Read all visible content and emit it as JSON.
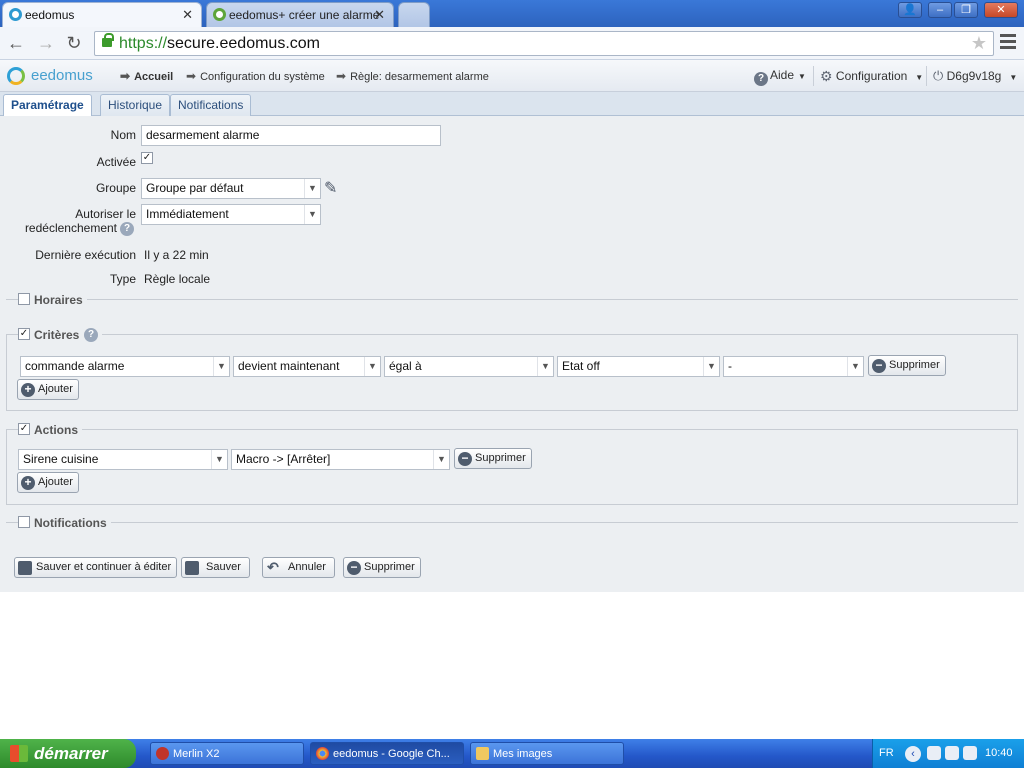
{
  "browser": {
    "tabs": [
      {
        "label": "eedomus",
        "close": "✕"
      },
      {
        "label": "eedomus+ créer une alarme",
        "close": "✕"
      }
    ],
    "url_scheme": "https://",
    "url_rest": "secure.eedomus.com",
    "window_controls": [
      "👤",
      "–",
      "❐",
      "✕"
    ]
  },
  "app": {
    "logo_text": "eedomus",
    "breadcrumb": [
      "Accueil",
      "Configuration du système",
      "Règle: desarmement alarme"
    ],
    "menu": {
      "help": "Aide",
      "config": "Configuration",
      "user": "D6g9v18g"
    },
    "subtabs": [
      "Paramétrage",
      "Historique",
      "Notifications"
    ]
  },
  "form": {
    "name_label": "Nom",
    "name_value": "desarmement alarme",
    "active_label": "Activée",
    "active_checked": true,
    "group_label": "Groupe",
    "group_value": "Groupe par défaut",
    "retrigger_label_1": "Autoriser le",
    "retrigger_label_2": "redéclenchement",
    "retrigger_value": "Immédiatement",
    "last_exec_label": "Dernière exécution",
    "last_exec_value": "Il y a 22 min",
    "type_label": "Type",
    "type_value": "Règle locale"
  },
  "sections": {
    "horaires": {
      "label": "Horaires",
      "checked": false
    },
    "criteres": {
      "label": "Critères",
      "checked": true,
      "row": [
        "commande alarme",
        "devient maintenant",
        "égal à",
        "Etat off",
        "-"
      ],
      "delete": "Supprimer",
      "add": "Ajouter"
    },
    "actions": {
      "label": "Actions",
      "checked": true,
      "row": [
        "Sirene cuisine",
        "Macro -> [Arrêter]"
      ],
      "delete": "Supprimer",
      "add": "Ajouter"
    },
    "notifications": {
      "label": "Notifications",
      "checked": false
    }
  },
  "buttons": {
    "save_continue": "Sauver et continuer à éditer",
    "save": "Sauver",
    "cancel": "Annuler",
    "delete": "Supprimer"
  },
  "taskbar": {
    "start": "démarrer",
    "tasks": [
      "Merlin X2",
      "eedomus - Google Ch...",
      "Mes images"
    ],
    "lang": "FR",
    "clock": "10:40"
  }
}
